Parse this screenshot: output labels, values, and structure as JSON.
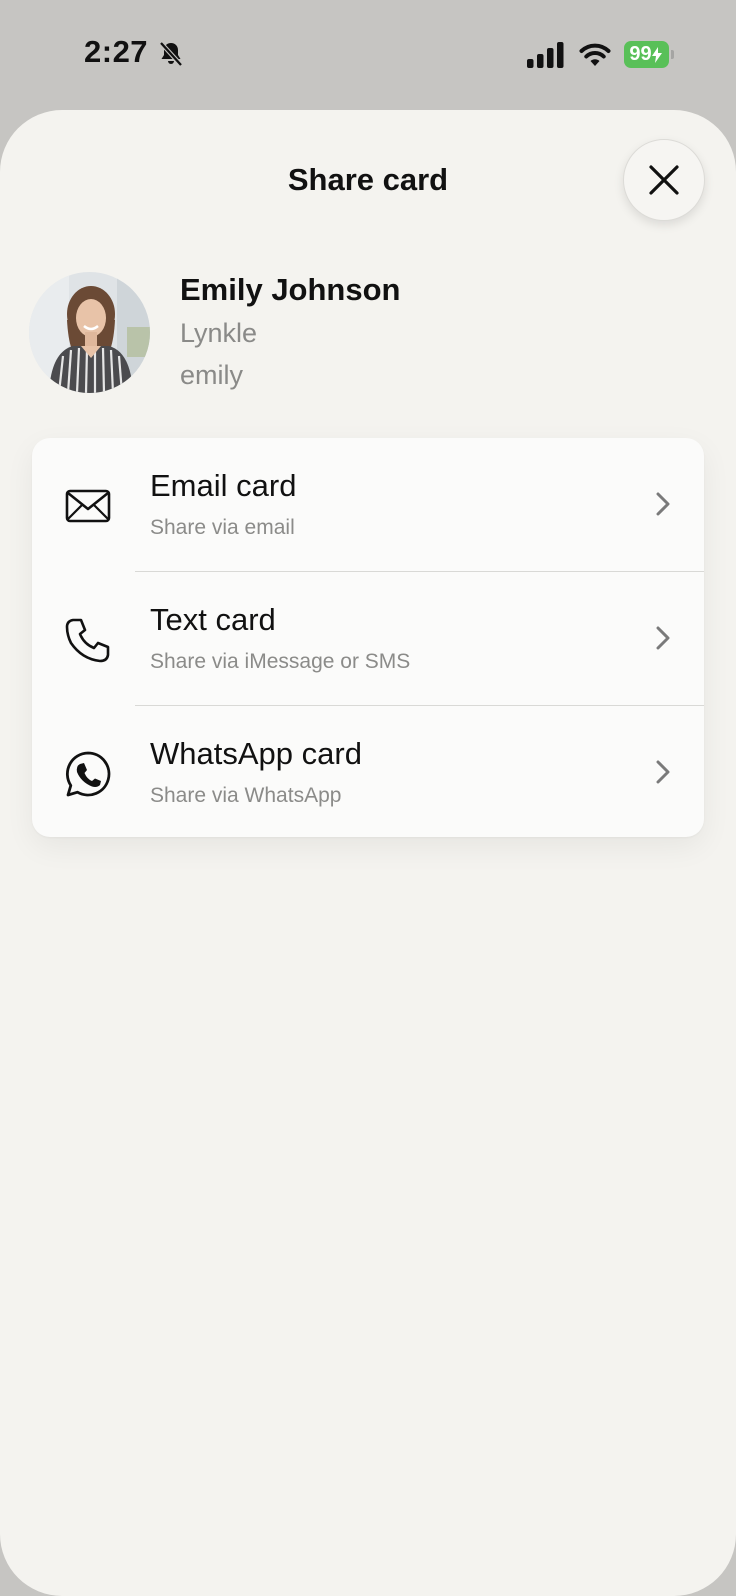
{
  "status_bar": {
    "time": "2:27",
    "battery": "99",
    "icons": [
      "bell-slash-icon",
      "cellular-signal-icon",
      "wifi-icon",
      "battery-charging-icon"
    ],
    "battery_color": "#59c058"
  },
  "sheet": {
    "title": "Share card",
    "close_icon": "close-icon"
  },
  "profile": {
    "name": "Emily Johnson",
    "company": "Lynkle",
    "username": "emily"
  },
  "share_options": [
    {
      "title": "Email card",
      "subtitle": "Share via email",
      "icon": "envelope-icon"
    },
    {
      "title": "Text card",
      "subtitle": "Share via iMessage or SMS",
      "icon": "phone-icon"
    },
    {
      "title": "WhatsApp card",
      "subtitle": "Share via WhatsApp",
      "icon": "whatsapp-icon"
    }
  ],
  "colors": {
    "sheet_background": "#f4f3ef",
    "backdrop": "#c6c5c2",
    "subtitle_gray": "#8b8b89"
  }
}
